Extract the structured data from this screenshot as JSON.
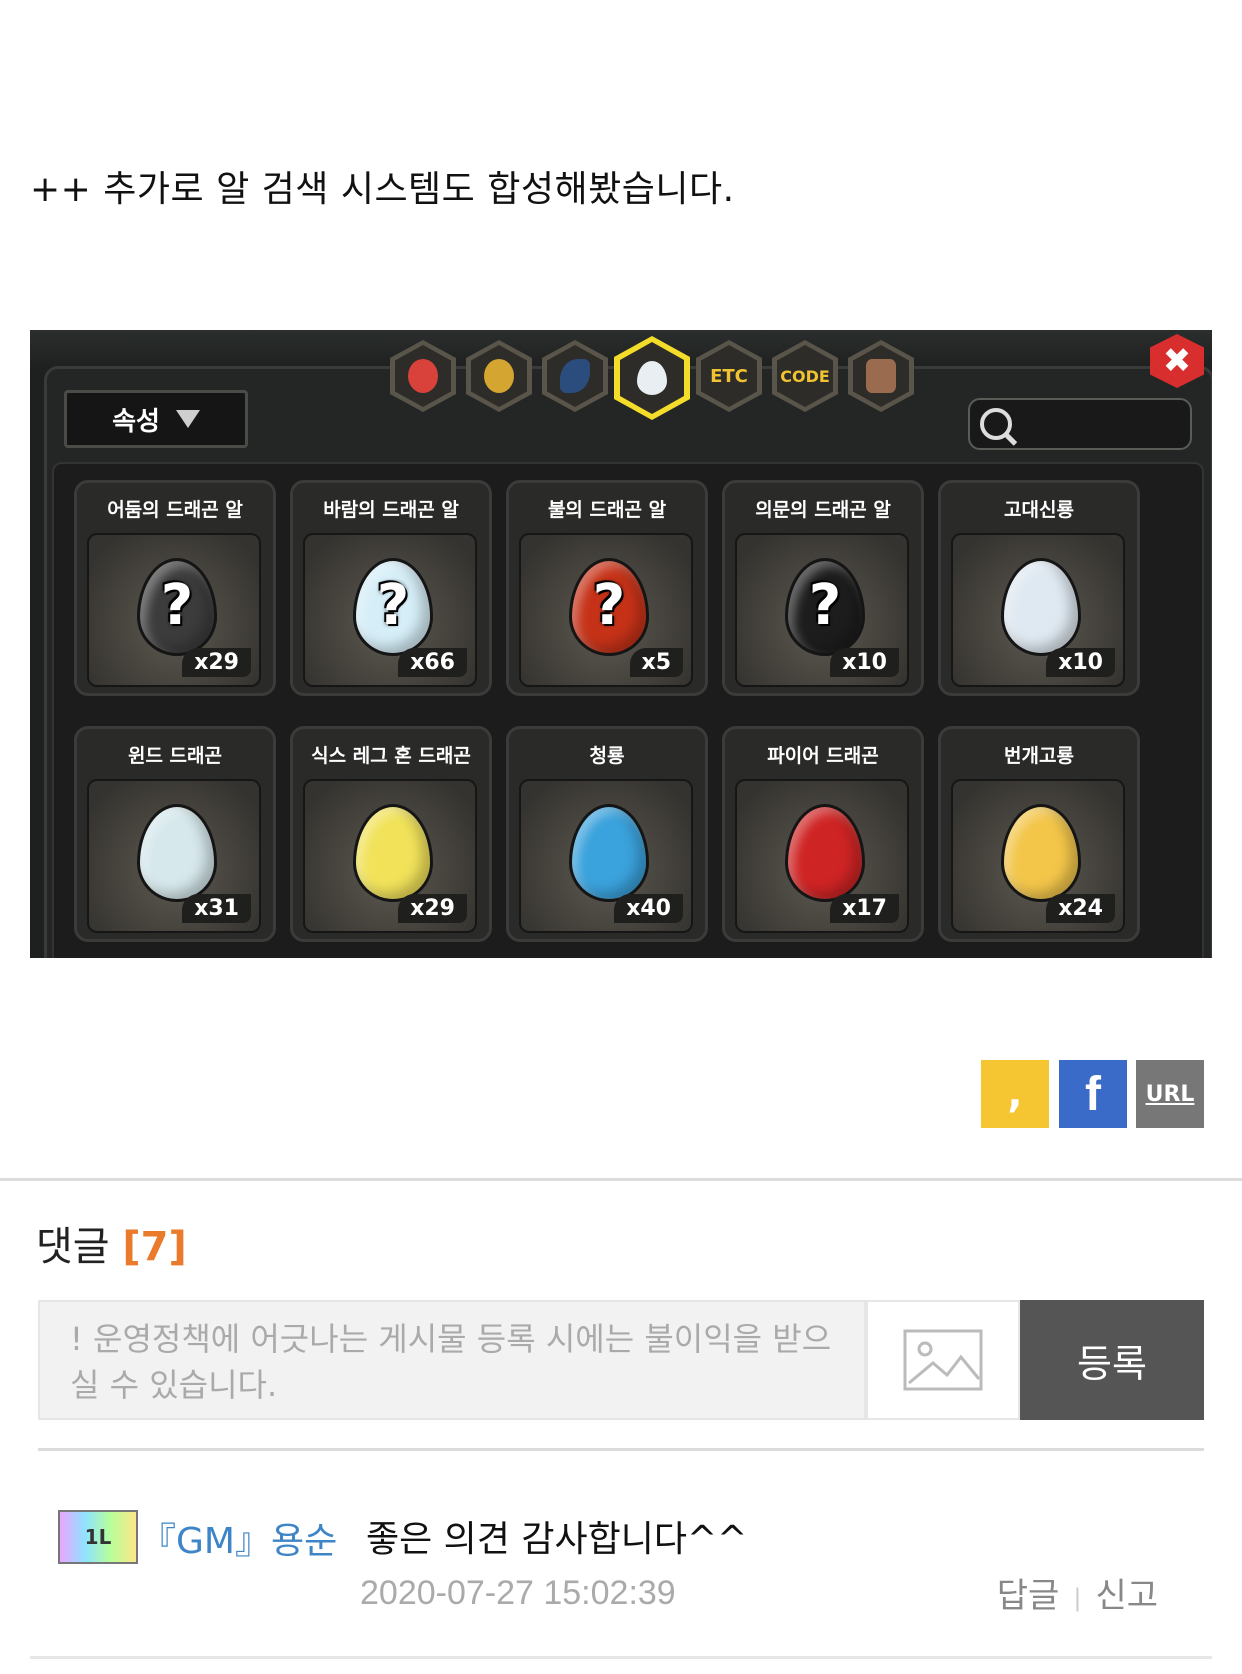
{
  "post": {
    "line": "++ 추가로 알 검색 시스템도 합성해봤습니다."
  },
  "game": {
    "tabs": [
      "",
      "",
      "",
      "",
      "ETC",
      "CODE",
      ""
    ],
    "filter_label": "속성",
    "close_icon": "✖",
    "cards": [
      {
        "title": "어둠의 드래곤 알",
        "count": "x29",
        "egg": "#3c3c3c",
        "q": true
      },
      {
        "title": "바람의 드래곤 알",
        "count": "x66",
        "egg": "#d6eef8",
        "q": true
      },
      {
        "title": "불의 드래곤 알",
        "count": "x5",
        "egg": "#c63218",
        "q": true
      },
      {
        "title": "의문의 드래곤 알",
        "count": "x10",
        "egg": "#1d1d1d",
        "q": true
      },
      {
        "title": "고대신룡",
        "count": "x10",
        "egg": "#dfe9f1",
        "q": false
      },
      {
        "title": "윈드 드래곤",
        "count": "x31",
        "egg": "#d6e8ec",
        "q": false
      },
      {
        "title": "식스 레그 혼 드래곤",
        "count": "x29",
        "egg": "#f1e25a",
        "q": false
      },
      {
        "title": "청룡",
        "count": "x40",
        "egg": "#3aa2dc",
        "q": false
      },
      {
        "title": "파이어 드래곤",
        "count": "x17",
        "egg": "#cf2424",
        "q": false
      },
      {
        "title": "번개고룡",
        "count": "x24",
        "egg": "#f3c64a",
        "q": false
      }
    ],
    "question_mark": "?"
  },
  "share": {
    "kakao": ",",
    "facebook": "f",
    "url": "URL"
  },
  "comments": {
    "heading": "댓글",
    "count": "[7]",
    "placeholder": "! 운영정책에 어긋나는 게시물 등록 시에는 불이익을 받으실 수 있습니다.",
    "submit": "등록",
    "items": [
      {
        "badge": "1L",
        "author": "『GM』용순",
        "body": "좋은 의견 감사합니다^^",
        "time": "2020-07-27 15:02:39",
        "reply": "답글",
        "report": "신고"
      }
    ]
  }
}
